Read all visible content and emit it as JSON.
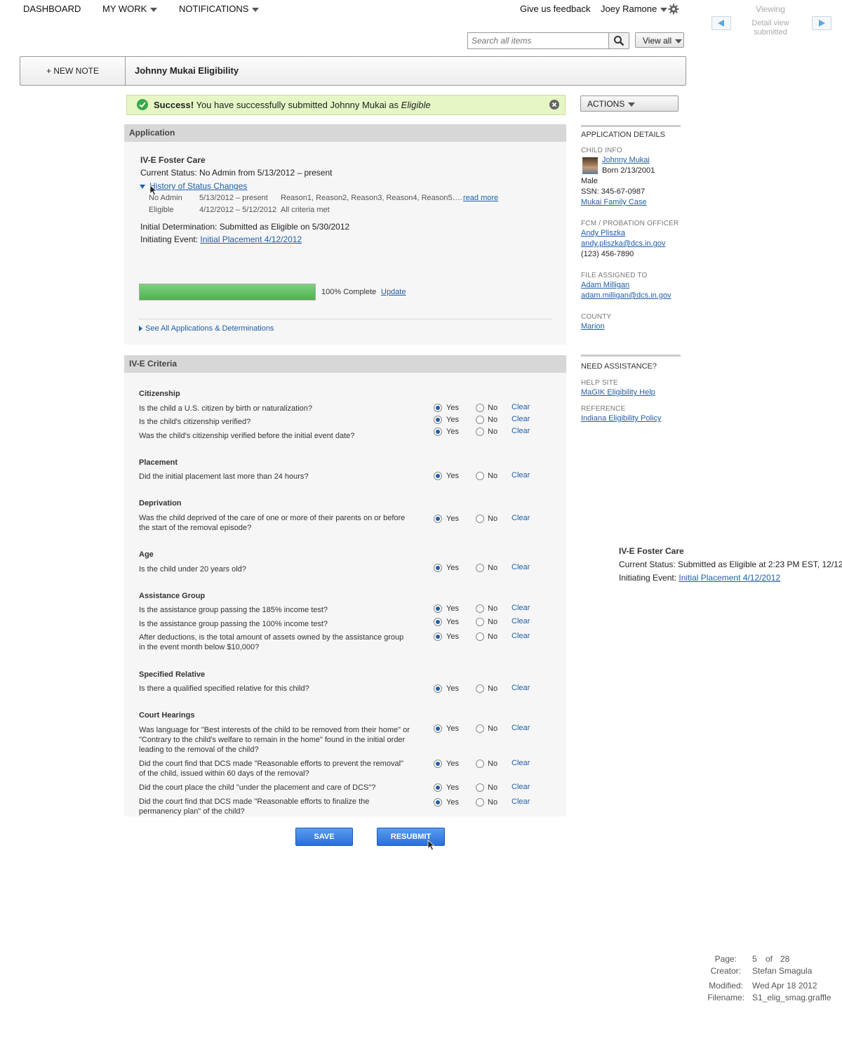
{
  "nav": {
    "dashboard": "DASHBOARD",
    "my_work": "MY WORK",
    "notifications": "NOTIFICATIONS",
    "feedback": "Give us feedback",
    "user": "Joey Ramone"
  },
  "viewing": {
    "label": "Viewing",
    "sub1": "Detail view",
    "sub2": "submitted"
  },
  "search": {
    "placeholder": "Search all items",
    "view_all": "View all"
  },
  "titlebar": {
    "new_note": "+ NEW NOTE",
    "title": "Johnny Mukai Eligibility"
  },
  "success": {
    "strong": "Success!",
    "text": " You have successfully submitted Johnny Mukai as ",
    "em": "Eligible"
  },
  "actions": {
    "label": "ACTIONS"
  },
  "application": {
    "header": "Application",
    "program": "IV-E Foster Care",
    "status": "Current Status: No Admin from 5/13/2012 – present",
    "history_link": "History of Status Changes",
    "history": [
      {
        "status": "No Admin",
        "range": "5/13/2012 – present",
        "reason": "Reason1, Reason2, Reason3, Reason4, Reason5….",
        "more": "read more"
      },
      {
        "status": "Eligible",
        "range": "4/12/2012 – 5/12/2012",
        "reason": "All criteria met",
        "more": ""
      }
    ],
    "determination": "Initial Determination: Submitted as Eligible on 5/30/2012",
    "event_label": "Initiating Event: ",
    "event_link": "Initial Placement 4/12/2012",
    "progress": 100,
    "progress_text": "100% Complete",
    "update": "Update",
    "see_all": "See All Applications & Determinations"
  },
  "criteria": {
    "header": "IV-E Criteria",
    "yes": "Yes",
    "no": "No",
    "clear": "Clear",
    "sections": [
      {
        "title": "Citizenship",
        "questions": [
          "Is the child a U.S. citizen by birth or naturalization?",
          "Is the child's citizenship verified?",
          "Was the child's citizenship verified before the initial event date?"
        ]
      },
      {
        "title": "Placement",
        "questions": [
          "Did the initial placement last more than 24 hours?"
        ]
      },
      {
        "title": "Deprivation",
        "questions": [
          "Was the child deprived of the care of one or more of their parents on or before the start of the removal episode?"
        ]
      },
      {
        "title": "Age",
        "questions": [
          "Is the child under 20 years old?"
        ]
      },
      {
        "title": "Assistance Group",
        "questions": [
          "Is the assistance group passing the 185% income test?",
          "Is the assistance group passing the 100% income test?",
          "After deductions, is the total amount of assets owned by the assistance group in the event month below $10,000?"
        ]
      },
      {
        "title": "Specified Relative",
        "questions": [
          "Is there a qualified specified relative for this child?"
        ]
      },
      {
        "title": "Court Hearings",
        "questions": [
          "Was language for \"Best interests of the child to be removed from their home\" or \"Contrary to the child's welfare to remain in the home\" found in the initial order leading to the removal of the child?",
          "Did the court find that DCS made \"Reasonable efforts to prevent the removal\" of the child, issued within 60 days of the removal?",
          "Did the court place the child \"under the placement and care of DCS\"?",
          "Did the court find that DCS made \"Reasonable efforts to finalize the permanency plan\" of the child?"
        ]
      }
    ]
  },
  "sidebar": {
    "details_hd": "APPLICATION DETAILS",
    "child_cap": "CHILD INFO",
    "child_name": "Johnny Mukai",
    "child_born": "Born 2/13/2001",
    "child_sex": "Male",
    "child_ssn": "SSN: 345-67-0987",
    "child_case": "Mukai Family Case",
    "fcm_cap": "FCM / PROBATION OFFICER",
    "fcm_name": "Andy Pliszka",
    "fcm_email": "andy.pliszka@dcs.in.gov",
    "fcm_phone": "(123) 456-7890",
    "file_cap": "FILE ASSIGNED TO",
    "file_name": "Adam Milligan",
    "file_email": "adam.milligan@dcs.in.gov",
    "county_cap": "COUNTY",
    "county": "Marion",
    "assist_hd": "NEED ASSISTANCE?",
    "help_cap": "HELP SITE",
    "help_link": "MaGIK Eligibility Help",
    "ref_cap": "REFERENCE",
    "ref_link": "Indiana Eligibility Policy"
  },
  "annotation": {
    "program": "IV-E Foster Care",
    "status": "Current Status:  Submitted as Eligible at 2:23 PM EST, 12/12",
    "event_label": "Initiating Event: ",
    "event_link": "Initial Placement 4/12/2012"
  },
  "buttons": {
    "save": "SAVE",
    "resubmit": "RESUBMIT"
  },
  "meta": {
    "page_label": "Page:",
    "page": "5",
    "of": "of",
    "total": "28",
    "creator_label": "Creator:",
    "creator": "Stefan Smagula",
    "modified_label": "Modified:",
    "modified": "Wed Apr 18 2012",
    "filename_label": "Filename:",
    "filename": "S1_elig_smag.graffle"
  },
  "colors": {
    "accent": "#1f5fa8",
    "success_bg": "#e6f7c5",
    "progress": "#5cc05c",
    "button": "#2a6fd8"
  }
}
